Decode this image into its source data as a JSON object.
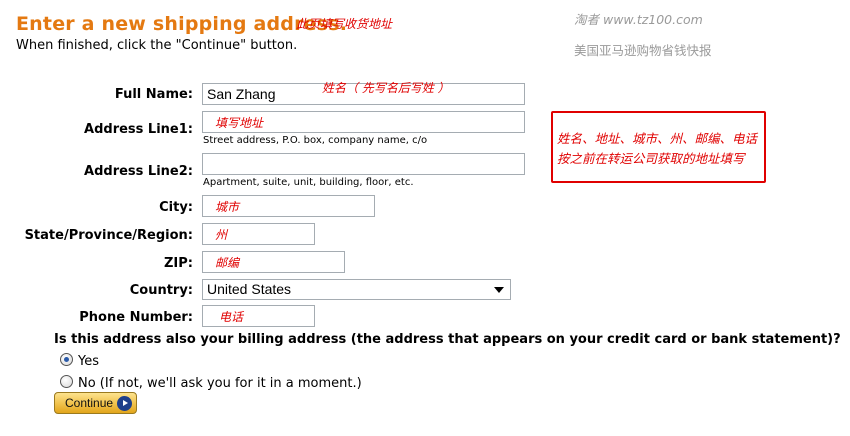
{
  "header": {
    "title": "Enter a new shipping address.",
    "subtitle": "When finished, click the \"Continue\" button.",
    "title_note": "此页填写收货地址"
  },
  "watermark": {
    "line1": "淘者  www.tz100.com",
    "line2": "美国亚马逊购物省钱快报"
  },
  "form": {
    "full_name": {
      "label": "Full Name:",
      "value": "San Zhang",
      "note": "姓名（ 先写名后写姓 ）"
    },
    "address1": {
      "label": "Address Line1:",
      "value": "填写地址",
      "hint": "Street address, P.O. box, company name, c/o"
    },
    "address2": {
      "label": "Address Line2:",
      "value": "",
      "hint": "Apartment, suite, unit, building, floor, etc."
    },
    "city": {
      "label": "City:",
      "value": "城市"
    },
    "state": {
      "label": "State/Province/Region:",
      "value": "州"
    },
    "zip": {
      "label": "ZIP:",
      "value": "邮编"
    },
    "country": {
      "label": "Country:",
      "value": "United States"
    },
    "phone": {
      "label": "Phone Number:",
      "value": "电话"
    }
  },
  "note_box": {
    "line1": "姓名、地址、城市、州、邮编、电话",
    "line2": "按之前在转运公司获取的地址填写"
  },
  "billing": {
    "question": "Is this address also your billing address (the address that appears on your credit card or bank statement)?",
    "yes_label": "Yes",
    "no_label": "No  (If not, we'll ask you for it in a moment.)",
    "selected": "yes"
  },
  "continue_button": {
    "label": "Continue"
  },
  "colors": {
    "title": "#e47911",
    "note_red": "#e00000",
    "button": "#f0c14b"
  }
}
